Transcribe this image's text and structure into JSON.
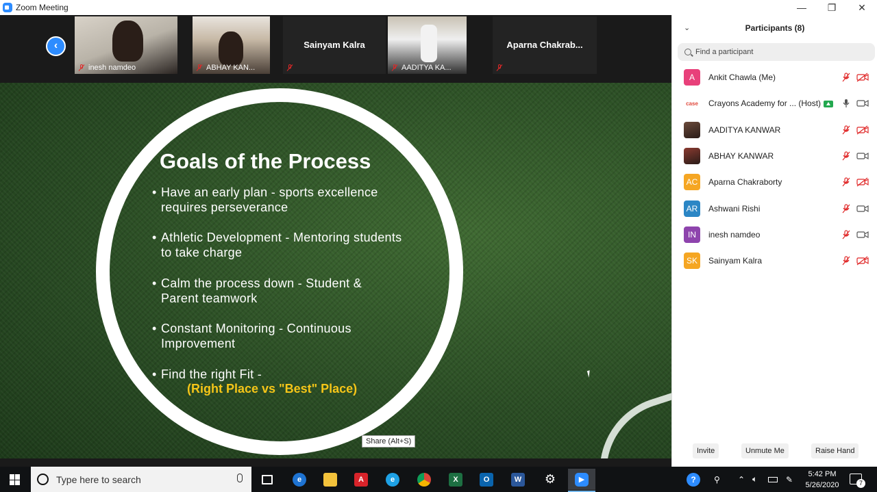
{
  "window": {
    "title": "Zoom Meeting",
    "controls": [
      "—",
      "❐",
      "✕"
    ]
  },
  "thumbnails": [
    {
      "name": "inesh namdeo",
      "muted": true,
      "video": true
    },
    {
      "name": "ABHAY KAN...",
      "muted": true,
      "video": true
    },
    {
      "name": "Sainyam Kalra",
      "muted": true,
      "video": false
    },
    {
      "name": "AADITYA KA...",
      "muted": true,
      "video": true
    },
    {
      "name": "Aparna  Chakrab...",
      "muted": true,
      "video": false
    }
  ],
  "slide": {
    "title": "Goals of the Process",
    "bullets": [
      "Have an early plan - sports excellence requires perseverance",
      "Athletic Development - Mentoring students to take charge",
      "Calm the process down - Student & Parent teamwork",
      "Constant Monitoring - Continuous Improvement",
      "Find the right Fit -"
    ],
    "highlight": "(Right Place vs \"Best\" Place)",
    "bullet_char": "•"
  },
  "tooltip": "Share (Alt+S)",
  "panel": {
    "title": "Participants (8)",
    "search_placeholder": "Find a participant",
    "participants": [
      {
        "initials": "A",
        "name": "Ankit Chawla (Me)",
        "color": "#e8407a",
        "type": "initials"
      },
      {
        "initials": "case",
        "name": "Crayons Academy for ... (Host)",
        "color": "#ffffff",
        "type": "logo"
      },
      {
        "initials": "",
        "name": "AADITYA KANWAR",
        "color": "#6b4a3a",
        "type": "photo"
      },
      {
        "initials": "",
        "name": "ABHAY KANWAR",
        "color": "#8a3a30",
        "type": "photo"
      },
      {
        "initials": "AC",
        "name": "Aparna Chakraborty",
        "color": "#f5a623",
        "type": "initials"
      },
      {
        "initials": "AR",
        "name": "Ashwani Rishi",
        "color": "#2b86c5",
        "type": "initials"
      },
      {
        "initials": "IN",
        "name": "inesh namdeo",
        "color": "#8e44ad",
        "type": "initials"
      },
      {
        "initials": "SK",
        "name": "Sainyam Kalra",
        "color": "#f5a623",
        "type": "initials"
      }
    ],
    "buttons": {
      "invite": "Invite",
      "unmute": "Unmute Me",
      "raise": "Raise Hand"
    }
  },
  "taskbar": {
    "search_placeholder": "Type here to search",
    "time": "5:42 PM",
    "date": "5/26/2020",
    "notifications": "7"
  }
}
